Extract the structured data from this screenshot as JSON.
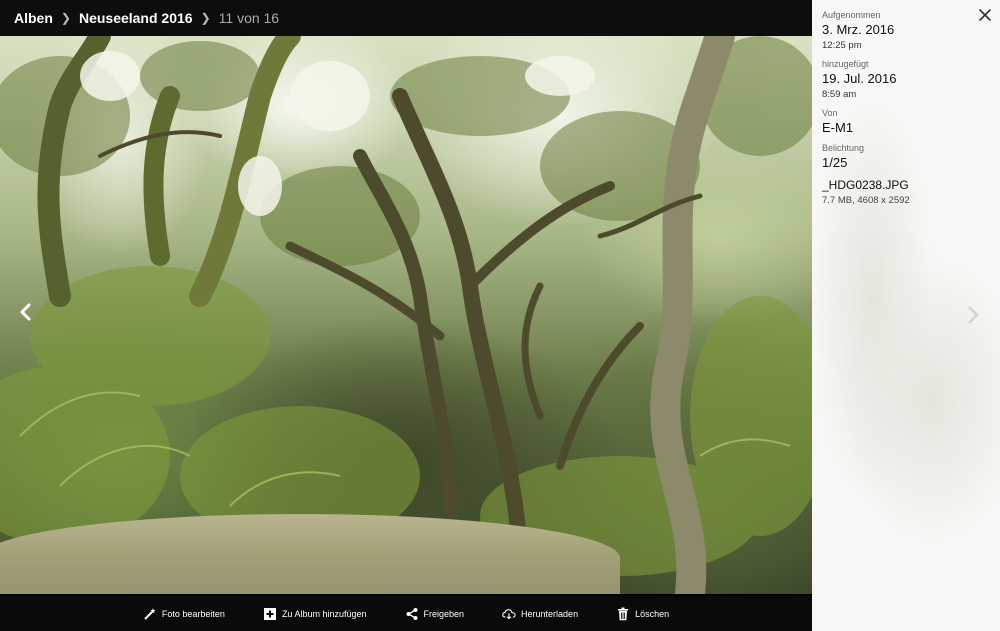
{
  "breadcrumb": {
    "albums": "Alben",
    "album": "Neuseeland 2016",
    "position": "11 von 16"
  },
  "toolbar": {
    "edit": "Foto bearbeiten",
    "add_to_album": "Zu Album hinzufügen",
    "share": "Freigeben",
    "download": "Herunterladen",
    "delete": "Löschen"
  },
  "info": {
    "taken_label": "Aufgenommen",
    "taken_date": "3. Mrz. 2016",
    "taken_time": "12:25 pm",
    "added_label": "hinzugefügt",
    "added_date": "19. Jul. 2016",
    "added_time": "8:59 am",
    "camera_label": "Von",
    "camera": "E-M1",
    "exposure_label": "Belichtung",
    "exposure": "1/25",
    "file_name": "_HDG0238.JPG",
    "file_meta": "7.7 MB, 4608 x 2592"
  },
  "icons": {
    "prev": "chevron-left-icon",
    "close": "close-icon",
    "edit": "magic-wand-icon",
    "add": "plus-square-icon",
    "share": "share-icon",
    "download": "cloud-download-icon",
    "delete": "trash-icon"
  }
}
